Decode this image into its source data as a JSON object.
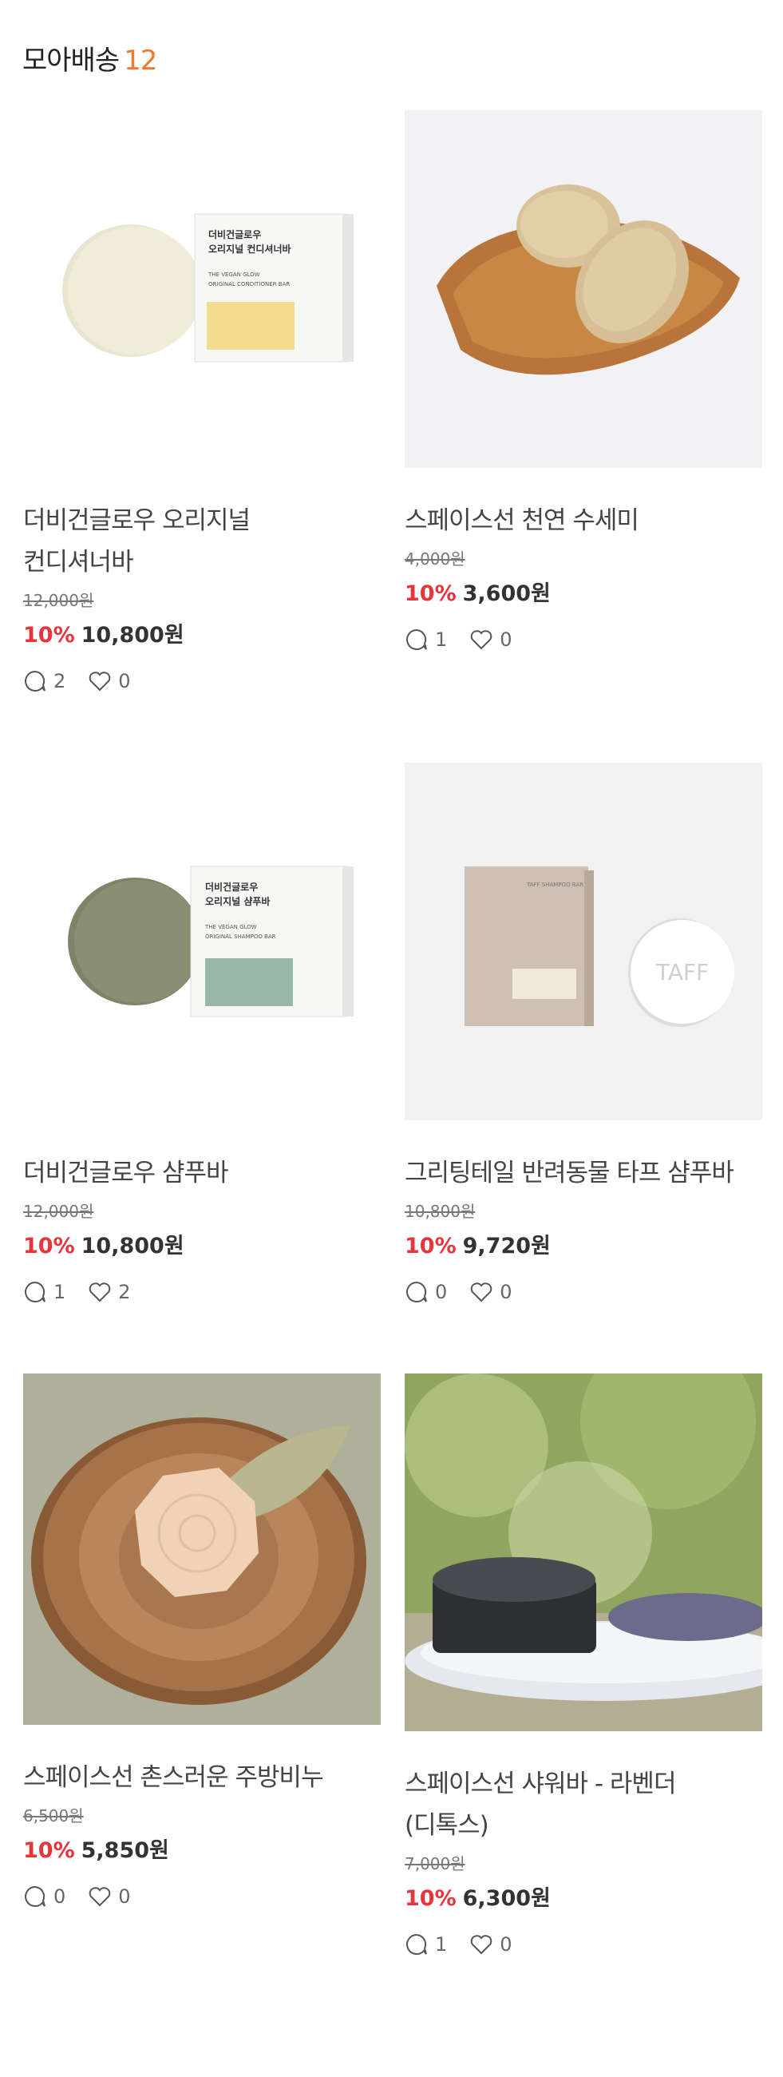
{
  "header": {
    "title": "모아배송",
    "count": "12"
  },
  "products": [
    {
      "name_lines": [
        "더비건글로우 오리지널",
        "컨디셔너바"
      ],
      "original_price": "12,000원",
      "discount": "10%",
      "price": "10,800원",
      "comments": "2",
      "likes": "0",
      "box_text": [
        "더비건글로우",
        "오리지널 컨디셔너바",
        "THE VEGAN GLOW",
        "ORIGINAL CONDITIONER BAR"
      ]
    },
    {
      "name_lines": [
        "스페이스선 천연 수세미"
      ],
      "original_price": "4,000원",
      "discount": "10%",
      "price": "3,600원",
      "comments": "1",
      "likes": "0"
    },
    {
      "name_lines": [
        "더비건글로우 샴푸바"
      ],
      "original_price": "12,000원",
      "discount": "10%",
      "price": "10,800원",
      "comments": "1",
      "likes": "2",
      "box_text": [
        "더비건글로우",
        "오리지널 샴푸바",
        "THE VEGAN GLOW",
        "ORIGINAL SHAMPOO BAR"
      ]
    },
    {
      "name_lines": [
        "그리팅테일 반려동물 타프 샴푸바"
      ],
      "original_price": "10,800원",
      "discount": "10%",
      "price": "9,720원",
      "comments": "0",
      "likes": "0",
      "box_text": [
        "TAFF SHAMPOO BAR",
        "TAFF"
      ]
    },
    {
      "name_lines": [
        "스페이스선 촌스러운 주방비누"
      ],
      "original_price": "6,500원",
      "discount": "10%",
      "price": "5,850원",
      "comments": "0",
      "likes": "0"
    },
    {
      "name_lines": [
        "스페이스선 샤워바 - 라벤더",
        "(디톡스)"
      ],
      "original_price": "7,000원",
      "discount": "10%",
      "price": "6,300원",
      "comments": "1",
      "likes": "0"
    }
  ],
  "colors": {
    "accent": "#f07a2c",
    "discount": "#e8343b"
  }
}
